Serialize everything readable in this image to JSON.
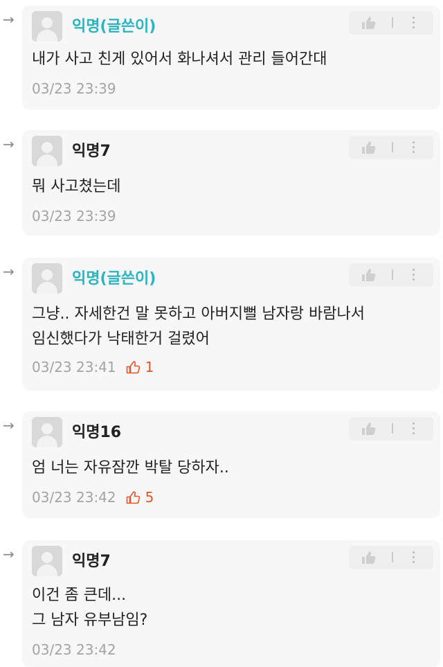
{
  "comments": [
    {
      "author": "익명(글쓴이)",
      "lines": [
        "내가 사고 친게 있어서 화나셔서 관리 들어간대"
      ],
      "time": "03/23 23:39",
      "likes": ""
    },
    {
      "author": "익명7",
      "lines": [
        "뭐 사고쳤는데"
      ],
      "time": "03/23 23:39",
      "likes": ""
    },
    {
      "author": "익명(글쓴이)",
      "lines": [
        "그냥.. 자세한건 말 못하고 아버지뻘 남자랑 바람나서",
        "임신했다가 낙태한거 걸렸어"
      ],
      "time": "03/23 23:41",
      "likes": "1"
    },
    {
      "author": "익명16",
      "lines": [
        "엄 너는 자유잠깐 박탈 당하자.."
      ],
      "time": "03/23 23:42",
      "likes": "5"
    },
    {
      "author": "익명7",
      "lines": [
        "이건 좀 큰데...",
        "그 남자 유부남임?"
      ],
      "time": "03/23 23:42",
      "likes": ""
    }
  ],
  "icons": {
    "reply_arrow": "→",
    "like": "thumbs-up-icon",
    "more": "more-vertical-icon",
    "liked": "thumbs-up-outline-icon"
  },
  "colors": {
    "op_author": "#2bb3c0",
    "like_accent": "#e0562c"
  }
}
